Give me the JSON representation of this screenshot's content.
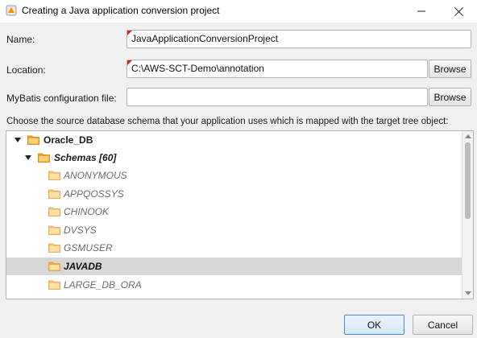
{
  "window": {
    "title": "Creating a Java application conversion project",
    "minimize_icon": "minimize-icon",
    "maximize_icon": "maximize-icon",
    "close_icon": "close-icon"
  },
  "form": {
    "name_label": "Name:",
    "name_value": "JavaApplicationConversionProject",
    "location_label": "Location:",
    "location_value": "C:\\AWS-SCT-Demo\\annotation",
    "browse_label": "Browse",
    "mybatis_label": "MyBatis configuration file:",
    "mybatis_value": "",
    "mybatis_browse_label": "Browse",
    "schema_prompt": "Choose the source database schema that your application uses which is mapped with the target tree object:"
  },
  "tree": {
    "root": "Oracle_DB",
    "schemas_node": "Schemas [60]",
    "items": [
      {
        "label": "ANONYMOUS",
        "selected": false
      },
      {
        "label": "APPQOSSYS",
        "selected": false
      },
      {
        "label": "CHINOOK",
        "selected": false
      },
      {
        "label": "DVSYS",
        "selected": false
      },
      {
        "label": "GSMUSER",
        "selected": false
      },
      {
        "label": "JAVADB",
        "selected": true
      },
      {
        "label": "LARGE_DB_ORA",
        "selected": false
      }
    ]
  },
  "buttons": {
    "ok": "OK",
    "cancel": "Cancel"
  },
  "colors": {
    "folder": "#f5a623",
    "folder_dim": "#f7c77a",
    "selection": "#d7d7d7",
    "ok_border": "#3c8fd8",
    "required_mark": "#e02020"
  }
}
